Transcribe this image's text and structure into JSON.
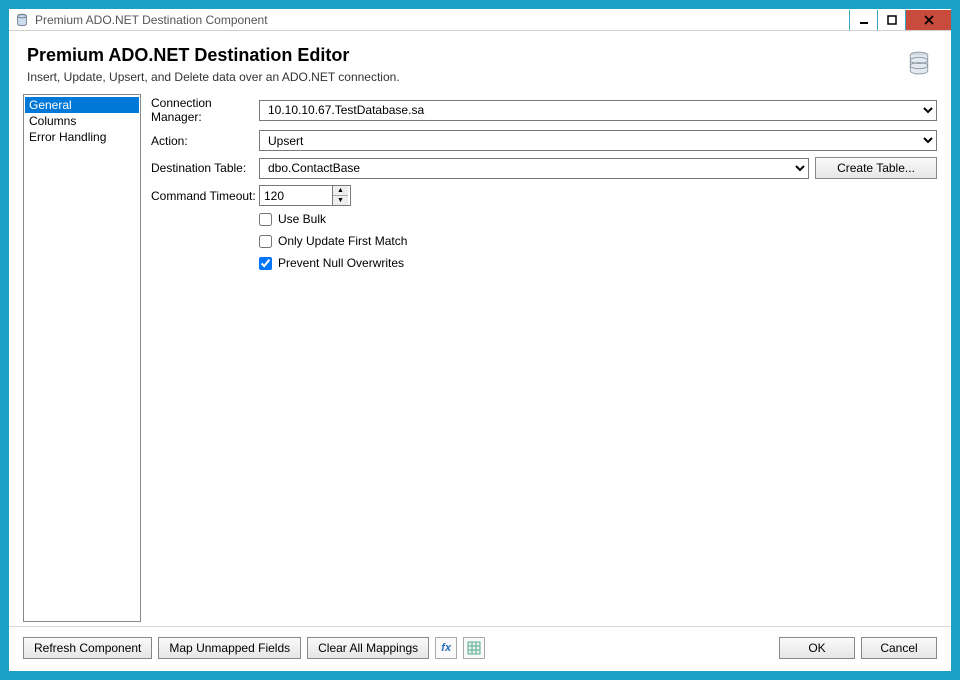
{
  "window": {
    "title": "Premium ADO.NET Destination Component"
  },
  "header": {
    "title": "Premium ADO.NET Destination Editor",
    "subtitle": "Insert, Update, Upsert, and Delete data over an ADO.NET connection."
  },
  "sidebar": {
    "items": [
      "General",
      "Columns",
      "Error Handling"
    ],
    "selected": "General"
  },
  "form": {
    "connection_label": "Connection Manager:",
    "connection_value": "10.10.10.67.TestDatabase.sa",
    "action_label": "Action:",
    "action_value": "Upsert",
    "table_label": "Destination Table:",
    "table_value": "dbo.ContactBase",
    "create_table_btn": "Create Table...",
    "timeout_label": "Command Timeout:",
    "timeout_value": "120",
    "checkboxes": {
      "use_bulk": {
        "label": "Use Bulk",
        "checked": false
      },
      "only_first": {
        "label": "Only Update First Match",
        "checked": false
      },
      "prevent_null": {
        "label": "Prevent Null Overwrites",
        "checked": true
      }
    }
  },
  "footer": {
    "refresh": "Refresh Component",
    "map_unmapped": "Map Unmapped Fields",
    "clear_all": "Clear All Mappings",
    "ok": "OK",
    "cancel": "Cancel"
  }
}
